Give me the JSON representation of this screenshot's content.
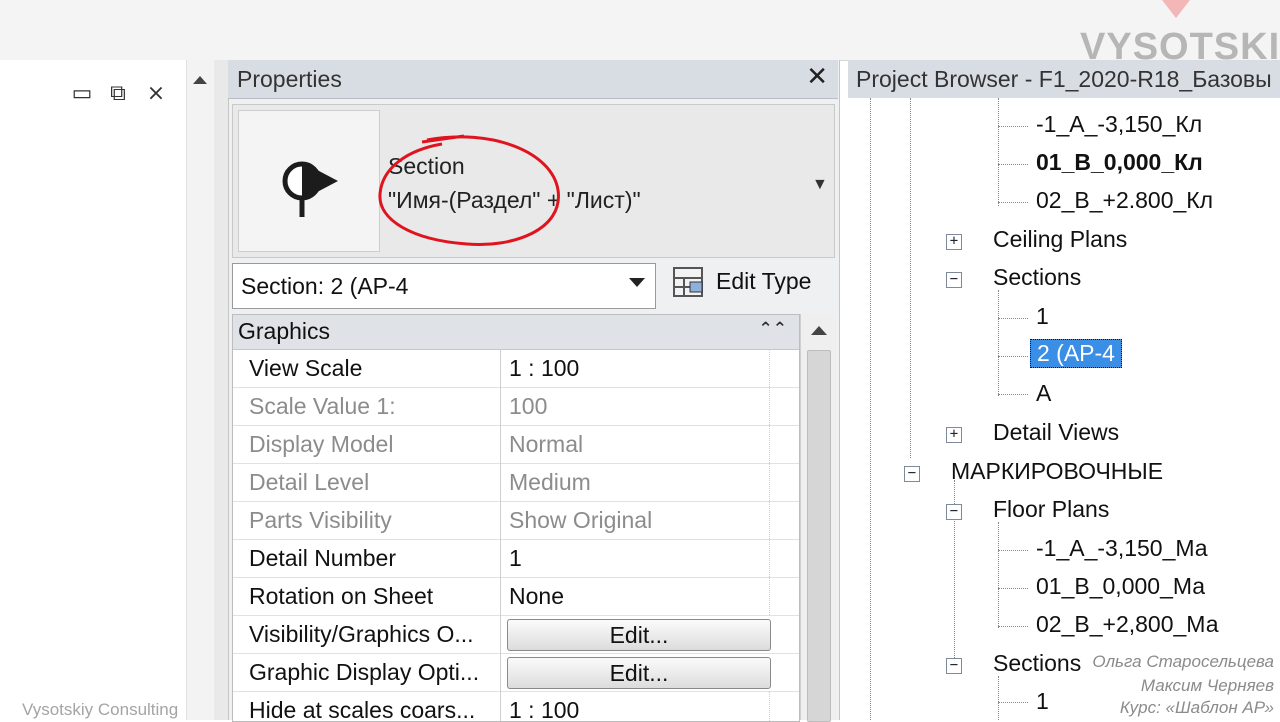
{
  "left_pane": {
    "window_controls": [
      "minimize-icon",
      "restore-icon",
      "close-icon"
    ]
  },
  "properties": {
    "title": "Properties",
    "close_glyph": "✕",
    "type": {
      "family": "Section",
      "name": "\"Имя-(Раздел\" + \"Лист)\""
    },
    "instance_selector": "Section: 2 (АР-4",
    "edit_type_label": "Edit Type",
    "group": {
      "name": "Graphics",
      "collapse_glyph": "⌃⌃"
    },
    "rows": [
      {
        "key": "View Scale",
        "value": "1 : 100",
        "dim": false
      },
      {
        "key": "Scale Value    1:",
        "value": "100",
        "dim": true
      },
      {
        "key": "Display Model",
        "value": "Normal",
        "dim": true
      },
      {
        "key": "Detail Level",
        "value": "Medium",
        "dim": true
      },
      {
        "key": "Parts Visibility",
        "value": "Show Original",
        "dim": true
      },
      {
        "key": "Detail Number",
        "value": "1",
        "dim": false
      },
      {
        "key": "Rotation on Sheet",
        "value": "None",
        "dim": false
      },
      {
        "key": "Visibility/Graphics O...",
        "button": "Edit...",
        "dim": false
      },
      {
        "key": "Graphic Display Opti...",
        "button": "Edit...",
        "dim": false
      },
      {
        "key": "Hide at scales coars...",
        "value": "1 : 100",
        "dim": false
      }
    ]
  },
  "project_browser": {
    "title": "Project Browser - F1_2020-R18_Базовы",
    "nodes": [
      {
        "label": "-1_А_-3,150_Кл",
        "bold": false
      },
      {
        "label": "01_В_0,000_Кл",
        "bold": true
      },
      {
        "label": "02_В_+2.800_Кл",
        "bold": false
      },
      {
        "label": "Ceiling Plans",
        "toggle": "+"
      },
      {
        "label": "Sections",
        "toggle": "−"
      },
      {
        "label": "1"
      },
      {
        "label": "2 (АР-4",
        "selected": true
      },
      {
        "label": "А"
      },
      {
        "label": "Detail Views",
        "toggle": "+"
      },
      {
        "label": "МАРКИРОВОЧНЫЕ",
        "toggle": "−"
      },
      {
        "label": "Floor Plans",
        "toggle": "−"
      },
      {
        "label": "-1_А_-3,150_Ма"
      },
      {
        "label": "01_В_0,000_Ма"
      },
      {
        "label": "02_В_+2,800_Ма"
      },
      {
        "label": "Sections",
        "toggle": "−"
      },
      {
        "label": "1"
      }
    ]
  },
  "watermark": {
    "brand": "VYSOTSKIY",
    "credits": [
      "Ольга Старосельцева",
      "Максим Черняев",
      "Курс: «Шаблон АР»"
    ],
    "consulting": "Vysotskiy Consulting"
  },
  "colors": {
    "selection": "#3a8ee6",
    "annotation_red": "#e0141e",
    "panel_header": "#d8dde4"
  }
}
